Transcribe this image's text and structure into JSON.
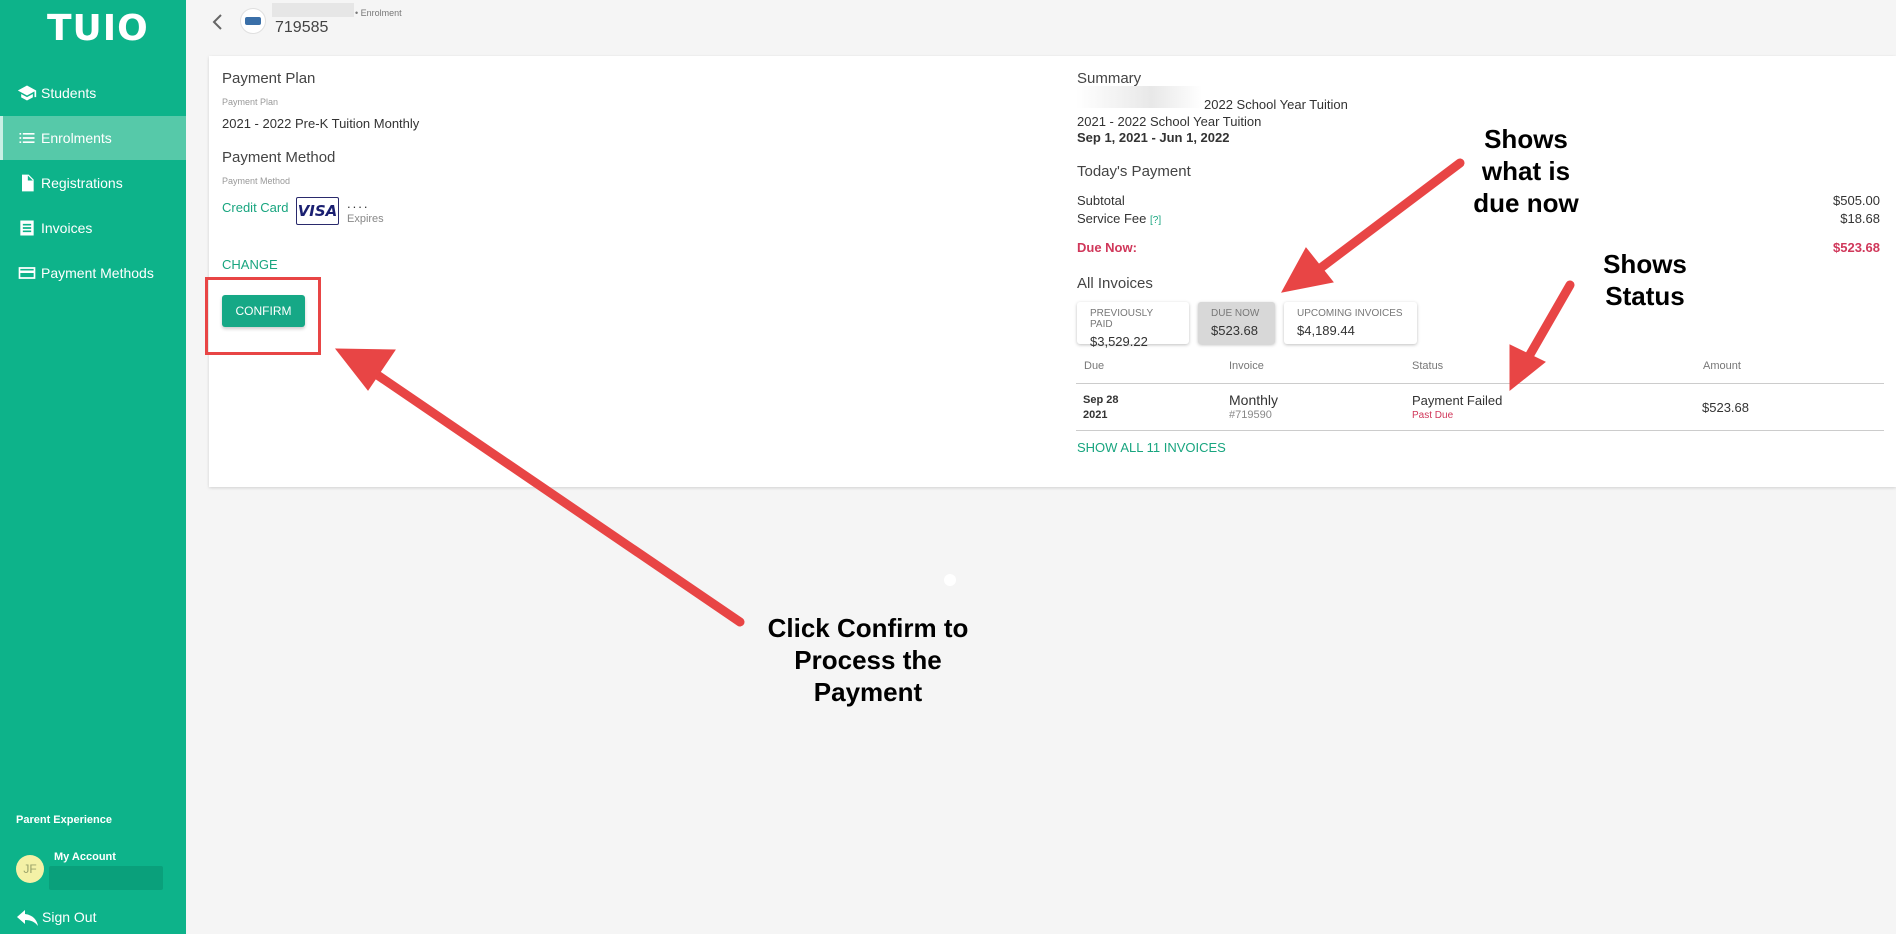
{
  "sidebar": {
    "logo": "TUIO",
    "items": [
      {
        "label": "Students",
        "icon": "graduation-cap-icon"
      },
      {
        "label": "Enrolments",
        "icon": "list-icon"
      },
      {
        "label": "Registrations",
        "icon": "document-icon"
      },
      {
        "label": "Invoices",
        "icon": "invoice-icon"
      },
      {
        "label": "Payment Methods",
        "icon": "credit-card-icon"
      }
    ],
    "parent_experience": "Parent Experience",
    "avatar_initials": "JF",
    "my_account": "My Account",
    "sign_out": "Sign Out"
  },
  "header": {
    "crumb_label": "• Enrolment",
    "enrolment_id": "719585"
  },
  "left": {
    "plan_title": "Payment Plan",
    "plan_label": "Payment Plan",
    "plan_value": "2021 - 2022 Pre-K Tuition Monthly",
    "method_title": "Payment Method",
    "method_label": "Payment Method",
    "method_type": "Credit Card",
    "card_brand": "VISA",
    "card_dots": "....",
    "expires": "Expires",
    "change": "CHANGE",
    "confirm": "CONFIRM"
  },
  "summary": {
    "title": "Summary",
    "line1": "2022 School Year Tuition",
    "line2": "2021 - 2022 School Year Tuition",
    "dates": "Sep 1, 2021 - Jun 1, 2022",
    "todays_payment": "Today's Payment",
    "subtotal_label": "Subtotal",
    "subtotal_value": "$505.00",
    "fee_label": "Service Fee",
    "fee_help": "[?]",
    "fee_value": "$18.68",
    "due_label": "Due Now:",
    "due_value": "$523.68",
    "all_invoices": "All Invoices",
    "pills": [
      {
        "label": "PREVIOUSLY PAID",
        "value": "$3,529.22"
      },
      {
        "label": "DUE NOW",
        "value": "$523.68"
      },
      {
        "label": "UPCOMING INVOICES",
        "value": "$4,189.44"
      }
    ],
    "columns": [
      "Due",
      "Invoice",
      "Status",
      "Amount"
    ],
    "rows": [
      {
        "due_month": "Sep 28",
        "due_year": "2021",
        "invoice": "Monthly",
        "invoice_no": "#719590",
        "status": "Payment Failed",
        "substatus": "Past Due",
        "amount": "$523.68"
      }
    ],
    "show_all": "SHOW ALL 11 INVOICES"
  },
  "annotations": {
    "confirm_note": [
      "Click Confirm to",
      "Process the",
      "Payment"
    ],
    "due_note": [
      "Shows",
      "what is",
      "due now"
    ],
    "status_note": [
      "Shows",
      "Status"
    ]
  },
  "colors": {
    "brand": "#0db38a",
    "accent_link": "#18a57f",
    "due_red": "#d0375a",
    "annotation_red": "#e84545"
  }
}
